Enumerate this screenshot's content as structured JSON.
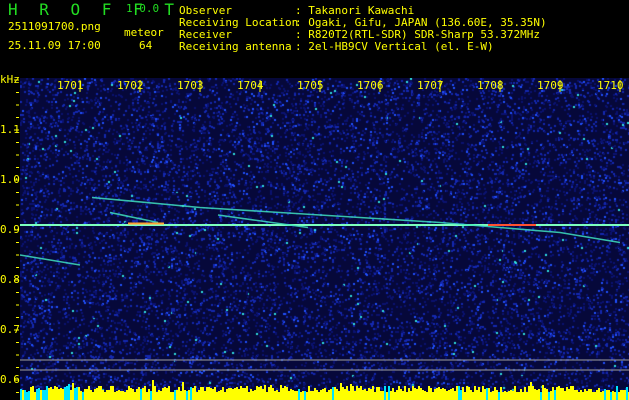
{
  "header": {
    "app_name": "H R O F F T",
    "version": "1.0.0",
    "filename": "2511091700.png",
    "datetime": "25.11.09 17:00",
    "meteor_label": "meteor",
    "meteor_count": "64",
    "info": [
      {
        "label": "Observer",
        "value": ": Takanori Kawachi"
      },
      {
        "label": "Receiving Location",
        "value": ": Ogaki, Gifu, JAPAN (136.60E, 35.35N)"
      },
      {
        "label": "Receiver",
        "value": ": R820T2(RTL-SDR) SDR-Sharp 53.372MHz"
      },
      {
        "label": "Receiving antenna",
        "value": ": 2el-HB9CV Vertical (el. E-W)"
      }
    ]
  },
  "colors": {
    "text": "#ffff00",
    "title": "#22dd22",
    "background": "#000000",
    "noise": "#1020a0",
    "histogram": "#ffff00",
    "histogram_alt": "#00e5ff"
  },
  "chart_data": {
    "type": "heatmap",
    "ylabel": "kHz",
    "xlim": [
      1700,
      1710
    ],
    "ylim": [
      0.6,
      1.2
    ],
    "x_ticks": [
      "1701",
      "1702",
      "1703",
      "1704",
      "1705",
      "1706",
      "1707",
      "1708",
      "1709",
      "1710"
    ],
    "y_ticks": [
      "1.1",
      "1.0",
      "0.9",
      "0.8",
      "0.7",
      "0.6"
    ],
    "y_tick_values": [
      1.1,
      1.0,
      0.9,
      0.8,
      0.7,
      0.6
    ],
    "carrier_khz": 0.91,
    "traces": [
      {
        "x": [
          1701.2,
          1703.0,
          1705.0,
          1707.0,
          1709.0,
          1710.0
        ],
        "y": [
          0.965,
          0.945,
          0.93,
          0.915,
          0.895,
          0.875
        ]
      },
      {
        "x": [
          1701.5,
          1702.3
        ],
        "y": [
          0.935,
          0.915
        ]
      },
      {
        "x": [
          1700.0,
          1701.0
        ],
        "y": [
          0.85,
          0.83
        ]
      },
      {
        "x": [
          1703.3,
          1704.8
        ],
        "y": [
          0.93,
          0.905
        ]
      }
    ],
    "reference_lines_khz": [
      0.62,
      0.6
    ]
  }
}
